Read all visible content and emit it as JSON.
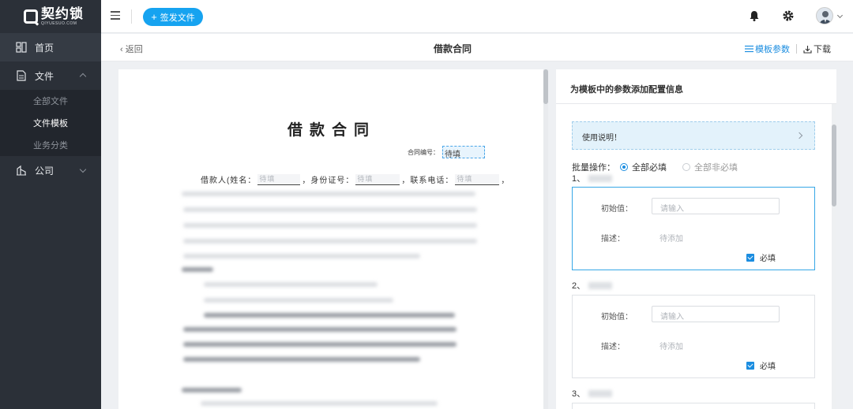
{
  "app": {
    "logo_title": "契约锁",
    "logo_sub": "QIYUESUO.COM"
  },
  "sidebar": {
    "items": [
      {
        "label": "首页"
      },
      {
        "label": "文件"
      },
      {
        "label": "公司"
      }
    ],
    "file_sub": [
      {
        "label": "全部文件"
      },
      {
        "label": "文件模板"
      },
      {
        "label": "业务分类"
      }
    ]
  },
  "topbar": {
    "sign_label": "签发文件",
    "sign_plus": "+"
  },
  "subheader": {
    "back_label": "返回",
    "title": "借款合同",
    "template_params_label": "模板参数",
    "download_label": "下载"
  },
  "document": {
    "title": "借款合同",
    "contract_no_label": "合同编号：",
    "contract_no_value": "待填",
    "borrower_prefix": "借款人(姓名：",
    "id_label": "，身份证号：",
    "phone_label": "，联系电话：",
    "placeholder": "待填",
    "end_mark": "，"
  },
  "panel": {
    "header": "为模板中的参数添加配置信息",
    "usage": "使用说明！",
    "batch_label": "批量操作：",
    "all_required": "全部必填",
    "all_optional": "全部非必填",
    "params": [
      {
        "num": "1、",
        "initial_label": "初始值：",
        "initial_placeholder": "请输入",
        "desc_label": "描述：",
        "desc_placeholder": "待添加",
        "required_label": "必填"
      },
      {
        "num": "2、",
        "initial_label": "初始值：",
        "initial_placeholder": "请输入",
        "desc_label": "描述：",
        "desc_placeholder": "待添加",
        "required_label": "必填"
      },
      {
        "num": "3、"
      }
    ]
  }
}
